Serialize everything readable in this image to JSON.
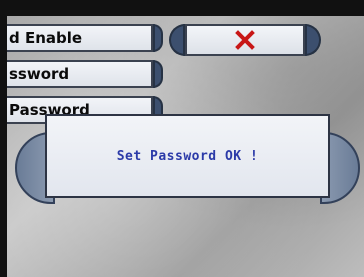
{
  "settings_rows": [
    {
      "label": "d Enable"
    },
    {
      "label": "ssword"
    },
    {
      "label": "Password"
    }
  ],
  "cancel_button": {
    "glyph": "✕",
    "color": "#c81616"
  },
  "dialog": {
    "message": "Set Password OK !",
    "text_color": "#2b3aa8"
  },
  "colors": {
    "panel_blue": "#3c4f6e",
    "panel_face": "#eef1f6",
    "background_gray": "#b4b4b4"
  }
}
